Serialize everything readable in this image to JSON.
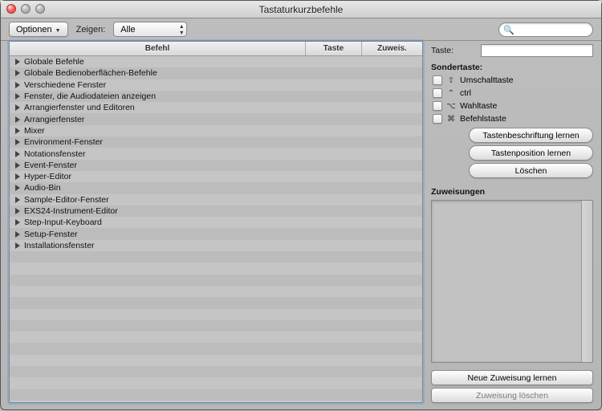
{
  "window": {
    "title": "Tastaturkurzbefehle"
  },
  "toolbar": {
    "optionen_label": "Optionen",
    "zeigen_label": "Zeigen:",
    "filter_selected": "Alle",
    "search_placeholder": ""
  },
  "table": {
    "columns": {
      "command": "Befehl",
      "key": "Taste",
      "assign": "Zuweis."
    },
    "rows": [
      {
        "label": "Globale Befehle"
      },
      {
        "label": "Globale Bedienoberflächen-Befehle"
      },
      {
        "label": "Verschiedene Fenster"
      },
      {
        "label": "Fenster, die Audiodateien anzeigen"
      },
      {
        "label": "Arrangierfenster und Editoren"
      },
      {
        "label": "Arrangierfenster"
      },
      {
        "label": "Mixer"
      },
      {
        "label": "Environment-Fenster"
      },
      {
        "label": "Notationsfenster"
      },
      {
        "label": "Event-Fenster"
      },
      {
        "label": "Hyper-Editor"
      },
      {
        "label": "Audio-Bin"
      },
      {
        "label": "Sample-Editor-Fenster"
      },
      {
        "label": "EXS24-Instrument-Editor"
      },
      {
        "label": "Step-Input-Keyboard"
      },
      {
        "label": "Setup-Fenster"
      },
      {
        "label": "Installationsfenster"
      }
    ]
  },
  "right": {
    "taste_label": "Taste:",
    "taste_value": "",
    "sondertaste_label": "Sondertaste:",
    "modifiers": {
      "shift_symbol": "⇧",
      "shift_label": "Umschalttaste",
      "ctrl_symbol": "⌃",
      "ctrl_label": "ctrl",
      "opt_symbol": "⌥",
      "opt_label": "Wahltaste",
      "cmd_symbol": "⌘",
      "cmd_label": "Befehlstaste"
    },
    "learn_label_btn": "Tastenbeschriftung lernen",
    "learn_pos_btn": "Tastenposition lernen",
    "delete_btn": "Löschen",
    "assignments_label": "Zuweisungen",
    "new_assign_btn": "Neue Zuweisung lernen",
    "delete_assign_btn": "Zuweisung löschen"
  }
}
